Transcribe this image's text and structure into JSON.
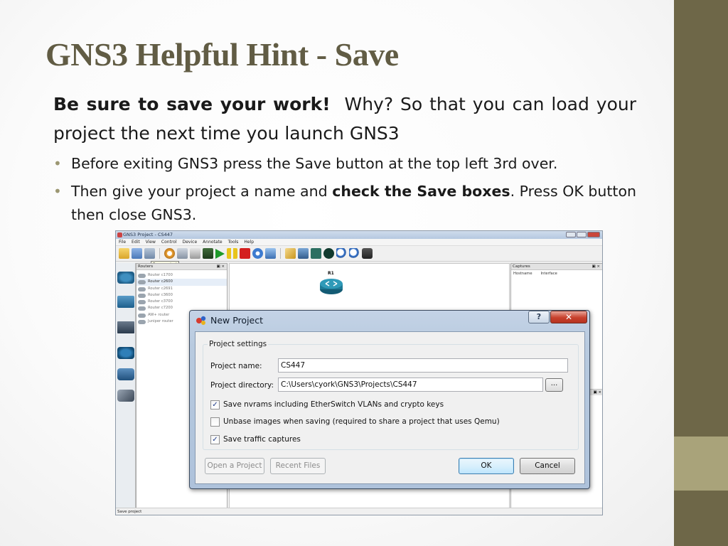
{
  "slide": {
    "title": "GNS3 Helpful Hint - Save",
    "lead_bold": "Be sure to save your work!",
    "lead_rest": "Why? So that you can load your project the next time you launch GNS3",
    "bullet1": "Before exiting GNS3 press the Save button at the top left 3rd over.",
    "bullet2_a": "Then give your project a name and ",
    "bullet2_bold": "check the Save boxes",
    "bullet2_b": ".  Press OK button then close GNS3.",
    "colors": {
      "side_bar": "#6e6748",
      "side_accent": "#a9a37a",
      "title": "#615c44"
    }
  },
  "app": {
    "window_title": "GNS3 Project - CS447",
    "menu": [
      "File",
      "Edit",
      "View",
      "Control",
      "Device",
      "Annotate",
      "Tools",
      "Help"
    ],
    "tooltip": "Save project",
    "routers_panel_title": "Routers",
    "routers": [
      "Router c1700",
      "Router c2600",
      "Router c2691",
      "Router c3600",
      "Router c3700",
      "Router c7200",
      "AW+ router",
      "Juniper router"
    ],
    "selected_router": "Router c2600",
    "canvas_node_label": "R1",
    "captures_panel_title": "Captures",
    "captures_columns": [
      "Hostname",
      "Interface"
    ],
    "status_bar": "Save project",
    "panel_buttons": "▣ ×"
  },
  "dialog": {
    "title": "New Project",
    "help_label": "?",
    "close_label": "✕",
    "group_title": "Project settings",
    "project_name_label": "Project name:",
    "project_name_value": "CS447",
    "project_dir_label": "Project directory:",
    "project_dir_value": "C:\\Users\\cyork\\GNS3\\Projects\\CS447",
    "browse_label": "...",
    "checkboxes": [
      {
        "label": "Save nvrams including EtherSwitch VLANs and crypto keys",
        "checked": true
      },
      {
        "label": "Unbase images when saving (required to share a project that uses Qemu)",
        "checked": false
      },
      {
        "label": "Save traffic captures",
        "checked": true
      }
    ],
    "open_project_label": "Open a Project",
    "recent_files_label": "Recent Files",
    "ok_label": "OK",
    "cancel_label": "Cancel"
  }
}
